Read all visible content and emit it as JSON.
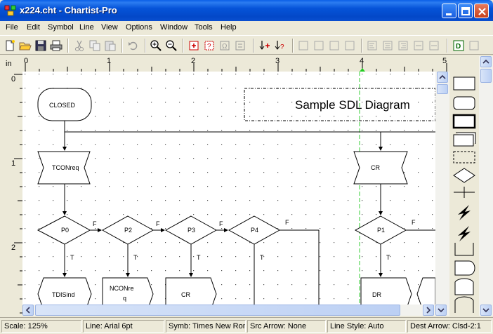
{
  "window": {
    "title": "x224.cht - Chartist-Pro"
  },
  "menu": [
    "File",
    "Edit",
    "Symbol",
    "Line",
    "View",
    "Options",
    "Window",
    "Tools",
    "Help"
  ],
  "ruler": {
    "unit": "in",
    "h_labels": [
      "0",
      "1",
      "2",
      "3",
      "4",
      "5"
    ],
    "v_labels": [
      "0",
      "1",
      "2"
    ]
  },
  "diagram": {
    "title": "Sample SDL Diagram",
    "closed": "CLOSED",
    "tconreq": "TCONreq",
    "cr_top": "CR",
    "p0": "P0",
    "p2": "P2",
    "p3": "P3",
    "p4": "P4",
    "p1": "P1",
    "f_label": "F",
    "t_label": "T",
    "tdisind": "TDISind",
    "nconreq_1": "NCONre",
    "nconreq_2": "q",
    "cr_bottom": "CR",
    "dr": "DR"
  },
  "status": {
    "scale": "Scale: 125%",
    "line": "Line: Arial 6pt",
    "symb": "Symb: Times New Roma",
    "src_arrow": "Src Arrow: None",
    "line_style": "Line Style: Auto",
    "dest_arrow": "Dest Arrow: Clsd-2:1"
  },
  "colors": {
    "titlebar": "#0553D8",
    "guide": "#33CC33",
    "chrome": "#ECE9D8"
  }
}
